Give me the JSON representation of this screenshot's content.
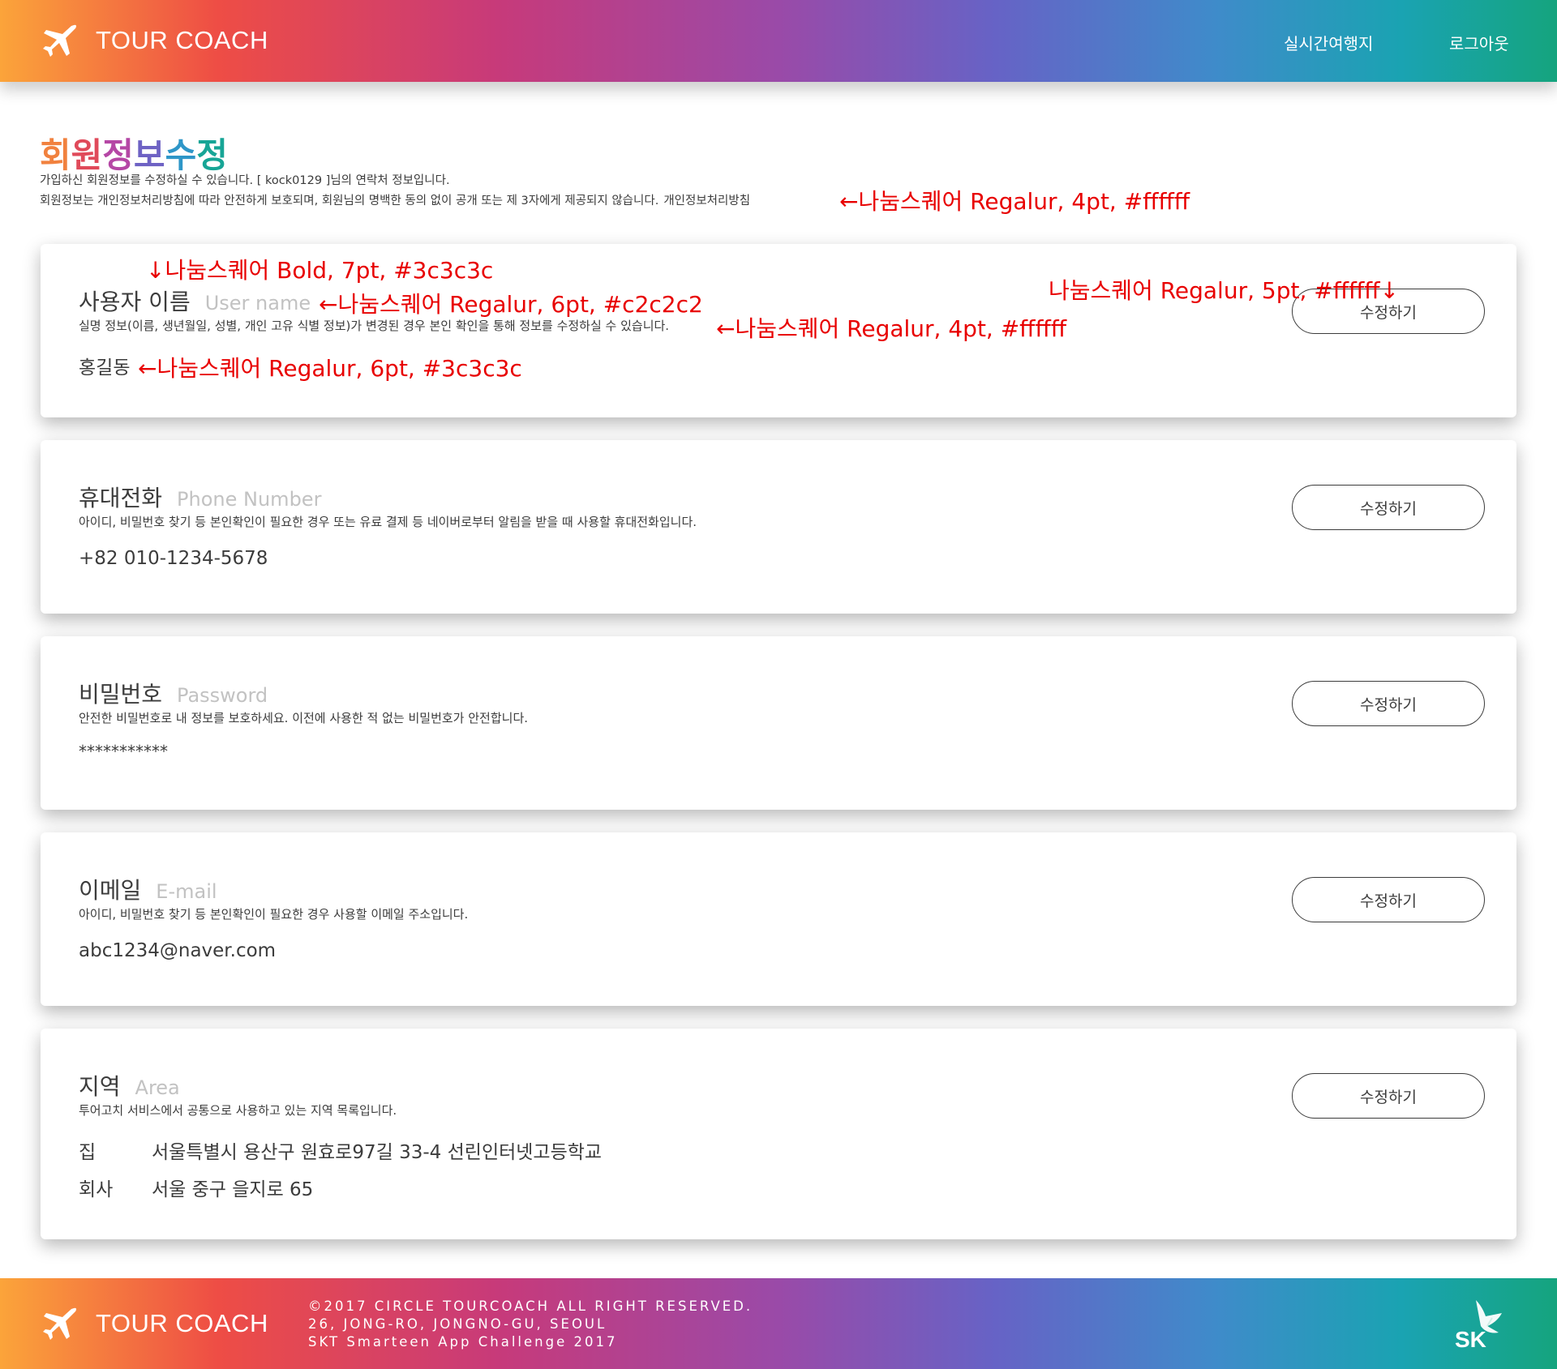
{
  "header": {
    "brand": "TOUR COACH",
    "nav": {
      "realtime": "실시간여행지",
      "logout": "로그아웃"
    }
  },
  "intro": {
    "title_chars": [
      "회",
      "원",
      "정",
      "보",
      "수",
      "정"
    ],
    "line1": "가입하신 회원정보를 수정하실 수 있습니다. [ kock0129 ]님의 연락처 정보입니다.",
    "line2": "회원정보는 개인정보처리방침에 따라 안전하게 보호되며, 회원님의 명백한 동의 없이 공개 또는 제 3자에게 제공되지 않습니다.",
    "policy_link": "개인정보처리방침"
  },
  "annotations": {
    "intro_desc": "←나눔스퀘어 Regalur, 4pt, #ffffff",
    "title_font": "↓나눔스퀘어 Bold, 7pt, #3c3c3c",
    "en_font": "←나눔스퀘어 Regalur, 6pt, #c2c2c2",
    "button_font": "나눔스퀘어 Regalur, 5pt, #ffffff↓",
    "desc_font": "←나눔스퀘어 Regalur, 4pt, #ffffff",
    "value_font": "←나눔스퀘어 Regalur, 6pt, #3c3c3c"
  },
  "cards": {
    "username": {
      "title": "사용자 이름",
      "subtitle": "User name",
      "desc": "실명 정보(이름, 생년월일, 성별, 개인 고유 식별 정보)가 변경된 경우 본인 확인을 통해 정보를 수정하실 수 있습니다.",
      "value": "홍길동",
      "button": "수정하기"
    },
    "phone": {
      "title": "휴대전화",
      "subtitle": "Phone Number",
      "desc": "아이디, 비밀번호 찾기 등 본인확인이 필요한 경우 또는 유료 결제 등 네이버로부터 알림을 받을 때 사용할 휴대전화입니다.",
      "value": "+82 010-1234-5678",
      "button": "수정하기"
    },
    "password": {
      "title": "비밀번호",
      "subtitle": "Password",
      "desc": "안전한 비밀번호로 내 정보를 보호하세요. 이전에 사용한 적 없는 비밀번호가 안전합니다.",
      "value": "***********",
      "button": "수정하기"
    },
    "email": {
      "title": "이메일",
      "subtitle": "E-mail",
      "desc": "아이디, 비밀번호 찾기 등 본인확인이 필요한 경우 사용할 이메일 주소입니다.",
      "value": "abc1234@naver.com",
      "button": "수정하기"
    },
    "area": {
      "title": "지역",
      "subtitle": "Area",
      "desc": "투어고치 서비스에서 공통으로 사용하고 있는 지역 목록입니다.",
      "rows": [
        {
          "label": "집",
          "value": "서울특별시 용산구 원효로97길 33-4 선린인터넷고등학교"
        },
        {
          "label": "회사",
          "value": "서울 중구 을지로 65"
        }
      ],
      "button": "수정하기"
    }
  },
  "footer": {
    "brand": "TOUR COACH",
    "lines": [
      "©2017 CIRCLE TOURCOACH ALL RIGHT RESERVED.",
      "26, JONG-RO, JONGNO-GU, SEOUL",
      "SKT Smarteen App Challenge 2017"
    ],
    "sk_logo": "SK"
  },
  "colors": {
    "gradient_start": "#fba43a",
    "gradient_end": "#15a47e",
    "text": "#3c3c3c",
    "muted": "#c2c2c2",
    "annotation": "#e80000"
  },
  "icons": {
    "brand": "airplane-icon",
    "sk": "sk-butterfly-logo"
  }
}
